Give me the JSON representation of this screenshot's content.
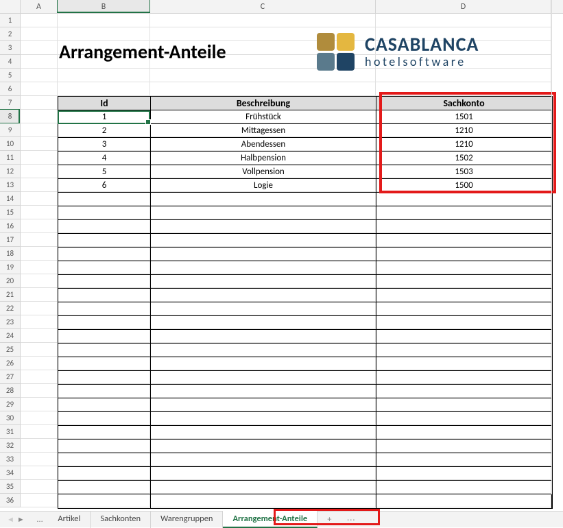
{
  "title": "Arrangement-Anteile",
  "logo": {
    "name": "CASABLANCA",
    "sub": "hotelsoftware"
  },
  "columns": [
    "A",
    "B",
    "C",
    "D"
  ],
  "row_numbers": [
    1,
    2,
    3,
    4,
    5,
    6,
    7,
    8,
    9,
    10,
    11,
    12,
    13,
    14,
    15,
    16,
    17,
    18,
    19,
    20,
    21,
    22,
    23,
    24,
    25,
    26,
    27,
    28,
    29,
    30,
    31,
    32,
    33,
    34,
    35,
    36
  ],
  "selected_cell": "B8",
  "selected_row": 8,
  "selected_column": "B",
  "table": {
    "headers": {
      "id": "Id",
      "beschreibung": "Beschreibung",
      "sachkonto": "Sachkonto"
    },
    "rows": [
      {
        "id": "1",
        "beschreibung": "Frühstück",
        "sachkonto": "1501"
      },
      {
        "id": "2",
        "beschreibung": "Mittagessen",
        "sachkonto": "1210"
      },
      {
        "id": "3",
        "beschreibung": "Abendessen",
        "sachkonto": "1210"
      },
      {
        "id": "4",
        "beschreibung": "Halbpension",
        "sachkonto": "1502"
      },
      {
        "id": "5",
        "beschreibung": "Vollpension",
        "sachkonto": "1503"
      },
      {
        "id": "6",
        "beschreibung": "Logie",
        "sachkonto": "1500"
      }
    ],
    "empty_rows": 23
  },
  "sheet_tabs": [
    {
      "label": "Artikel",
      "active": false
    },
    {
      "label": "Sachkonten",
      "active": false
    },
    {
      "label": "Warengruppen",
      "active": false
    },
    {
      "label": "Arrangement-Anteile",
      "active": true
    }
  ],
  "colors": {
    "excel_green": "#217346",
    "highlight_red": "#e31a1a",
    "header_gray": "#dddddd"
  }
}
